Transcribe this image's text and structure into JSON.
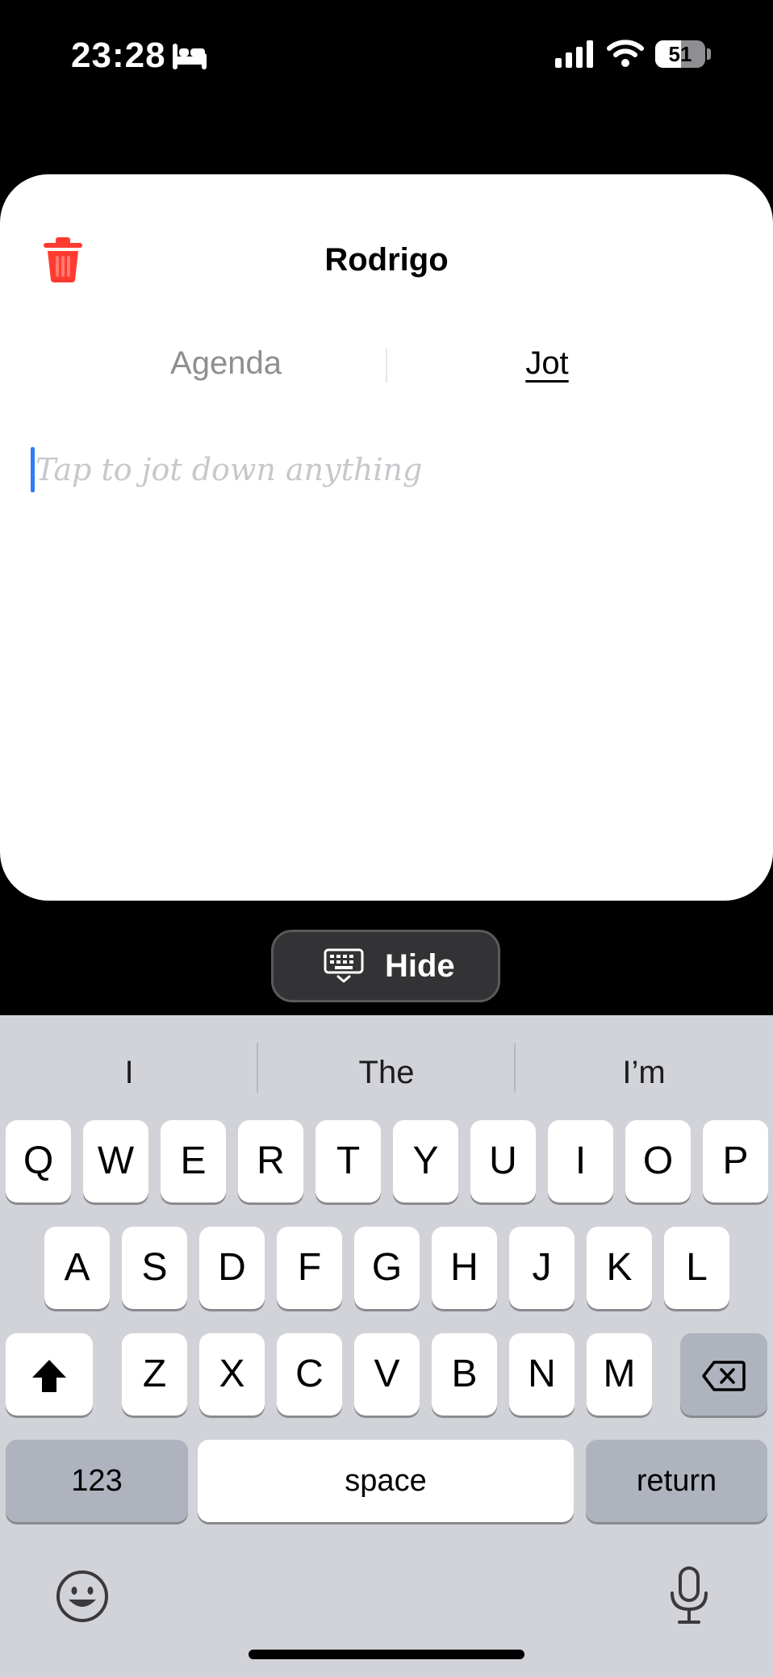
{
  "status_bar": {
    "time": "23:28",
    "battery_percent": "51",
    "battery_level": 0.51,
    "icons": [
      "sleep-focus-icon",
      "cellular-signal-icon",
      "wifi-icon",
      "battery-icon"
    ]
  },
  "sheet": {
    "title": "Rodrigo",
    "delete_icon": "trash-icon",
    "tabs": [
      {
        "label": "Agenda",
        "selected": false
      },
      {
        "label": "Jot",
        "selected": true
      }
    ],
    "jot_placeholder": "Tap to jot down anything",
    "jot_value": ""
  },
  "hide_keyboard": {
    "icon": "keyboard-hide-icon",
    "label": "Hide"
  },
  "keyboard": {
    "suggestions": [
      "I",
      "The",
      "I’m"
    ],
    "row1": [
      "Q",
      "W",
      "E",
      "R",
      "T",
      "Y",
      "U",
      "I",
      "O",
      "P"
    ],
    "row2": [
      "A",
      "S",
      "D",
      "F",
      "G",
      "H",
      "J",
      "K",
      "L"
    ],
    "row3": [
      "Z",
      "X",
      "C",
      "V",
      "B",
      "N",
      "M"
    ],
    "numbers_label": "123",
    "space_label": "space",
    "return_label": "return",
    "icons": [
      "shift-icon",
      "delete-icon",
      "emoji-icon",
      "microphone-icon"
    ]
  },
  "colors": {
    "accent": "#2f7cf6",
    "trash": "#ff3b30",
    "keyboard_bg": "#d1d3d9"
  }
}
